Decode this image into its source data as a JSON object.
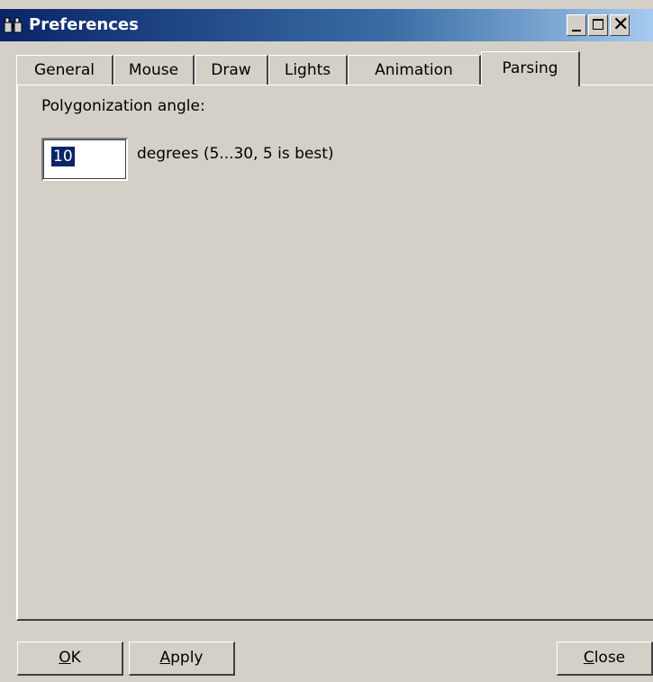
{
  "window": {
    "title": "Preferences",
    "icon": "binoculars-icon"
  },
  "tabs": [
    {
      "label": "General"
    },
    {
      "label": "Mouse"
    },
    {
      "label": "Draw"
    },
    {
      "label": "Lights"
    },
    {
      "label": "Animation"
    },
    {
      "label": "Parsing",
      "active": true
    }
  ],
  "parsing": {
    "angle_label": "Polygonization angle:",
    "angle_value": "10",
    "angle_hint": "degrees (5...30, 5 is best)"
  },
  "buttons": {
    "ok": {
      "accel": "O",
      "rest": "K"
    },
    "apply": {
      "accel": "A",
      "rest": "pply"
    },
    "close": {
      "accel": "C",
      "rest": "lose"
    }
  }
}
